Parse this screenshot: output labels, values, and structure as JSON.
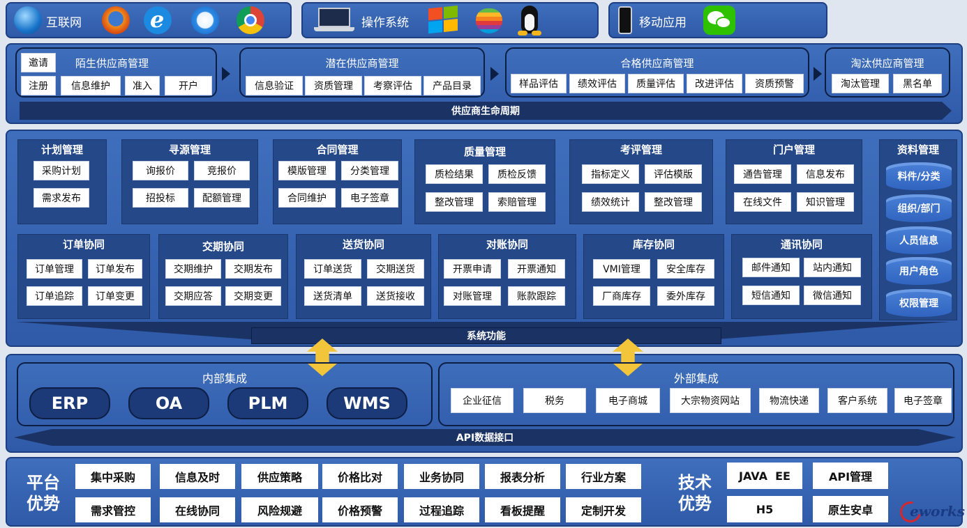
{
  "top_bar": {
    "internet": {
      "label": "互联网",
      "icons": [
        "globe-icon",
        "firefox-icon",
        "ie-icon",
        "safari-icon",
        "chrome-icon"
      ]
    },
    "os": {
      "label": "操作系统",
      "icons": [
        "laptop-icon",
        "windows-icon",
        "apple-icon",
        "linux-icon"
      ]
    },
    "mobile": {
      "label": "移动应用",
      "icons": [
        "phone-icon",
        "wechat-icon"
      ]
    }
  },
  "lifecycle": {
    "band": "供应商生命周期",
    "stranger": {
      "title": "陌生供应商管理",
      "items": [
        "邀请",
        "注册",
        "信息维护",
        "准入",
        "开户"
      ]
    },
    "potential": {
      "title": "潜在供应商管理",
      "items": [
        "信息验证",
        "资质管理",
        "考察评估",
        "产品目录"
      ]
    },
    "qualified": {
      "title": "合格供应商管理",
      "items": [
        "样品评估",
        "绩效评估",
        "质量评估",
        "改进评估",
        "资质预警"
      ]
    },
    "eliminated": {
      "title": "淘汰供应商管理",
      "items": [
        "淘汰管理",
        "黑名单"
      ]
    }
  },
  "functions": {
    "band": "系统功能",
    "row1": [
      {
        "title": "计划管理",
        "items": [
          "采购计划",
          "需求发布"
        ]
      },
      {
        "title": "寻源管理",
        "items": [
          "询报价",
          "竞报价",
          "招投标",
          "配额管理"
        ]
      },
      {
        "title": "合同管理",
        "items": [
          "模版管理",
          "分类管理",
          "合同维护",
          "电子签章"
        ]
      },
      {
        "title": "质量管理",
        "items": [
          "质检结果",
          "质检反馈",
          "整改管理",
          "索赔管理"
        ]
      },
      {
        "title": "考评管理",
        "items": [
          "指标定义",
          "评估模版",
          "绩效统计",
          "整改管理"
        ]
      },
      {
        "title": "门户管理",
        "items": [
          "通告管理",
          "信息发布",
          "在线文件",
          "知识管理"
        ]
      }
    ],
    "row2": [
      {
        "title": "订单协同",
        "items": [
          "订单管理",
          "订单发布",
          "订单追踪",
          "订单变更"
        ]
      },
      {
        "title": "交期协同",
        "items": [
          "交期维护",
          "交期发布",
          "交期应答",
          "交期变更"
        ]
      },
      {
        "title": "送货协同",
        "items": [
          "订单送货",
          "交期送货",
          "送货清单",
          "送货接收"
        ]
      },
      {
        "title": "对账协同",
        "items": [
          "开票申请",
          "开票通知",
          "对账管理",
          "账款跟踪"
        ]
      },
      {
        "title": "库存协同",
        "items": [
          "VMI管理",
          "安全库存",
          "厂商库存",
          "委外库存"
        ]
      },
      {
        "title": "通讯协同",
        "items": [
          "邮件通知",
          "站内通知",
          "短信通知",
          "微信通知"
        ]
      }
    ],
    "data_mgmt": {
      "title": "资料管理",
      "items": [
        "料件/分类",
        "组织/部门",
        "人员信息",
        "用户角色",
        "权限管理"
      ]
    }
  },
  "integration": {
    "band": "API数据接口",
    "internal": {
      "title": "内部集成",
      "items": [
        "ERP",
        "OA",
        "PLM",
        "WMS"
      ]
    },
    "external": {
      "title": "外部集成",
      "items": [
        "企业征信",
        "税务",
        "电子商城",
        "大宗物资网站",
        "物流快递",
        "客户系统",
        "电子签章"
      ]
    }
  },
  "advantages": {
    "platform": {
      "title_1": "平台",
      "title_2": "优势",
      "row1": [
        "集中采购",
        "信息及时",
        "供应策略",
        "价格比对",
        "业务协同",
        "报表分析",
        "行业方案"
      ],
      "row2": [
        "需求管控",
        "在线协同",
        "风险规避",
        "价格预警",
        "过程追踪",
        "看板提醒",
        "定制开发"
      ]
    },
    "tech": {
      "title_1": "技术",
      "title_2": "优势",
      "row1": [
        "JAVA  EE",
        "API管理"
      ],
      "row2": [
        "H5",
        "原生安卓"
      ]
    }
  },
  "logo": "eworks",
  "colors": {
    "panel": "#3a66b4",
    "dark_box": "#244888",
    "band": "#1b3265",
    "arrow": "#f3c53a"
  }
}
